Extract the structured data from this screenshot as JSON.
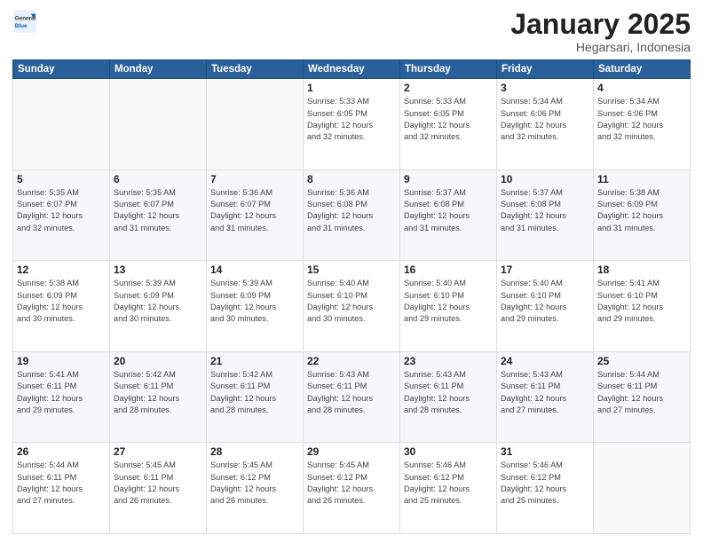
{
  "header": {
    "logo_general": "General",
    "logo_blue": "Blue",
    "title": "January 2025",
    "subtitle": "Hegarsari, Indonesia"
  },
  "weekdays": [
    "Sunday",
    "Monday",
    "Tuesday",
    "Wednesday",
    "Thursday",
    "Friday",
    "Saturday"
  ],
  "weeks": [
    [
      {
        "day": "",
        "info": ""
      },
      {
        "day": "",
        "info": ""
      },
      {
        "day": "",
        "info": ""
      },
      {
        "day": "1",
        "info": "Sunrise: 5:33 AM\nSunset: 6:05 PM\nDaylight: 12 hours\nand 32 minutes."
      },
      {
        "day": "2",
        "info": "Sunrise: 5:33 AM\nSunset: 6:05 PM\nDaylight: 12 hours\nand 32 minutes."
      },
      {
        "day": "3",
        "info": "Sunrise: 5:34 AM\nSunset: 6:06 PM\nDaylight: 12 hours\nand 32 minutes."
      },
      {
        "day": "4",
        "info": "Sunrise: 5:34 AM\nSunset: 6:06 PM\nDaylight: 12 hours\nand 32 minutes."
      }
    ],
    [
      {
        "day": "5",
        "info": "Sunrise: 5:35 AM\nSunset: 6:07 PM\nDaylight: 12 hours\nand 32 minutes."
      },
      {
        "day": "6",
        "info": "Sunrise: 5:35 AM\nSunset: 6:07 PM\nDaylight: 12 hours\nand 31 minutes."
      },
      {
        "day": "7",
        "info": "Sunrise: 5:36 AM\nSunset: 6:07 PM\nDaylight: 12 hours\nand 31 minutes."
      },
      {
        "day": "8",
        "info": "Sunrise: 5:36 AM\nSunset: 6:08 PM\nDaylight: 12 hours\nand 31 minutes."
      },
      {
        "day": "9",
        "info": "Sunrise: 5:37 AM\nSunset: 6:08 PM\nDaylight: 12 hours\nand 31 minutes."
      },
      {
        "day": "10",
        "info": "Sunrise: 5:37 AM\nSunset: 6:08 PM\nDaylight: 12 hours\nand 31 minutes."
      },
      {
        "day": "11",
        "info": "Sunrise: 5:38 AM\nSunset: 6:09 PM\nDaylight: 12 hours\nand 31 minutes."
      }
    ],
    [
      {
        "day": "12",
        "info": "Sunrise: 5:38 AM\nSunset: 6:09 PM\nDaylight: 12 hours\nand 30 minutes."
      },
      {
        "day": "13",
        "info": "Sunrise: 5:39 AM\nSunset: 6:09 PM\nDaylight: 12 hours\nand 30 minutes."
      },
      {
        "day": "14",
        "info": "Sunrise: 5:39 AM\nSunset: 6:09 PM\nDaylight: 12 hours\nand 30 minutes."
      },
      {
        "day": "15",
        "info": "Sunrise: 5:40 AM\nSunset: 6:10 PM\nDaylight: 12 hours\nand 30 minutes."
      },
      {
        "day": "16",
        "info": "Sunrise: 5:40 AM\nSunset: 6:10 PM\nDaylight: 12 hours\nand 29 minutes."
      },
      {
        "day": "17",
        "info": "Sunrise: 5:40 AM\nSunset: 6:10 PM\nDaylight: 12 hours\nand 29 minutes."
      },
      {
        "day": "18",
        "info": "Sunrise: 5:41 AM\nSunset: 6:10 PM\nDaylight: 12 hours\nand 29 minutes."
      }
    ],
    [
      {
        "day": "19",
        "info": "Sunrise: 5:41 AM\nSunset: 6:11 PM\nDaylight: 12 hours\nand 29 minutes."
      },
      {
        "day": "20",
        "info": "Sunrise: 5:42 AM\nSunset: 6:11 PM\nDaylight: 12 hours\nand 28 minutes."
      },
      {
        "day": "21",
        "info": "Sunrise: 5:42 AM\nSunset: 6:11 PM\nDaylight: 12 hours\nand 28 minutes."
      },
      {
        "day": "22",
        "info": "Sunrise: 5:43 AM\nSunset: 6:11 PM\nDaylight: 12 hours\nand 28 minutes."
      },
      {
        "day": "23",
        "info": "Sunrise: 5:43 AM\nSunset: 6:11 PM\nDaylight: 12 hours\nand 28 minutes."
      },
      {
        "day": "24",
        "info": "Sunrise: 5:43 AM\nSunset: 6:11 PM\nDaylight: 12 hours\nand 27 minutes."
      },
      {
        "day": "25",
        "info": "Sunrise: 5:44 AM\nSunset: 6:11 PM\nDaylight: 12 hours\nand 27 minutes."
      }
    ],
    [
      {
        "day": "26",
        "info": "Sunrise: 5:44 AM\nSunset: 6:11 PM\nDaylight: 12 hours\nand 27 minutes."
      },
      {
        "day": "27",
        "info": "Sunrise: 5:45 AM\nSunset: 6:11 PM\nDaylight: 12 hours\nand 26 minutes."
      },
      {
        "day": "28",
        "info": "Sunrise: 5:45 AM\nSunset: 6:12 PM\nDaylight: 12 hours\nand 26 minutes."
      },
      {
        "day": "29",
        "info": "Sunrise: 5:45 AM\nSunset: 6:12 PM\nDaylight: 12 hours\nand 26 minutes."
      },
      {
        "day": "30",
        "info": "Sunrise: 5:46 AM\nSunset: 6:12 PM\nDaylight: 12 hours\nand 25 minutes."
      },
      {
        "day": "31",
        "info": "Sunrise: 5:46 AM\nSunset: 6:12 PM\nDaylight: 12 hours\nand 25 minutes."
      },
      {
        "day": "",
        "info": ""
      }
    ]
  ]
}
